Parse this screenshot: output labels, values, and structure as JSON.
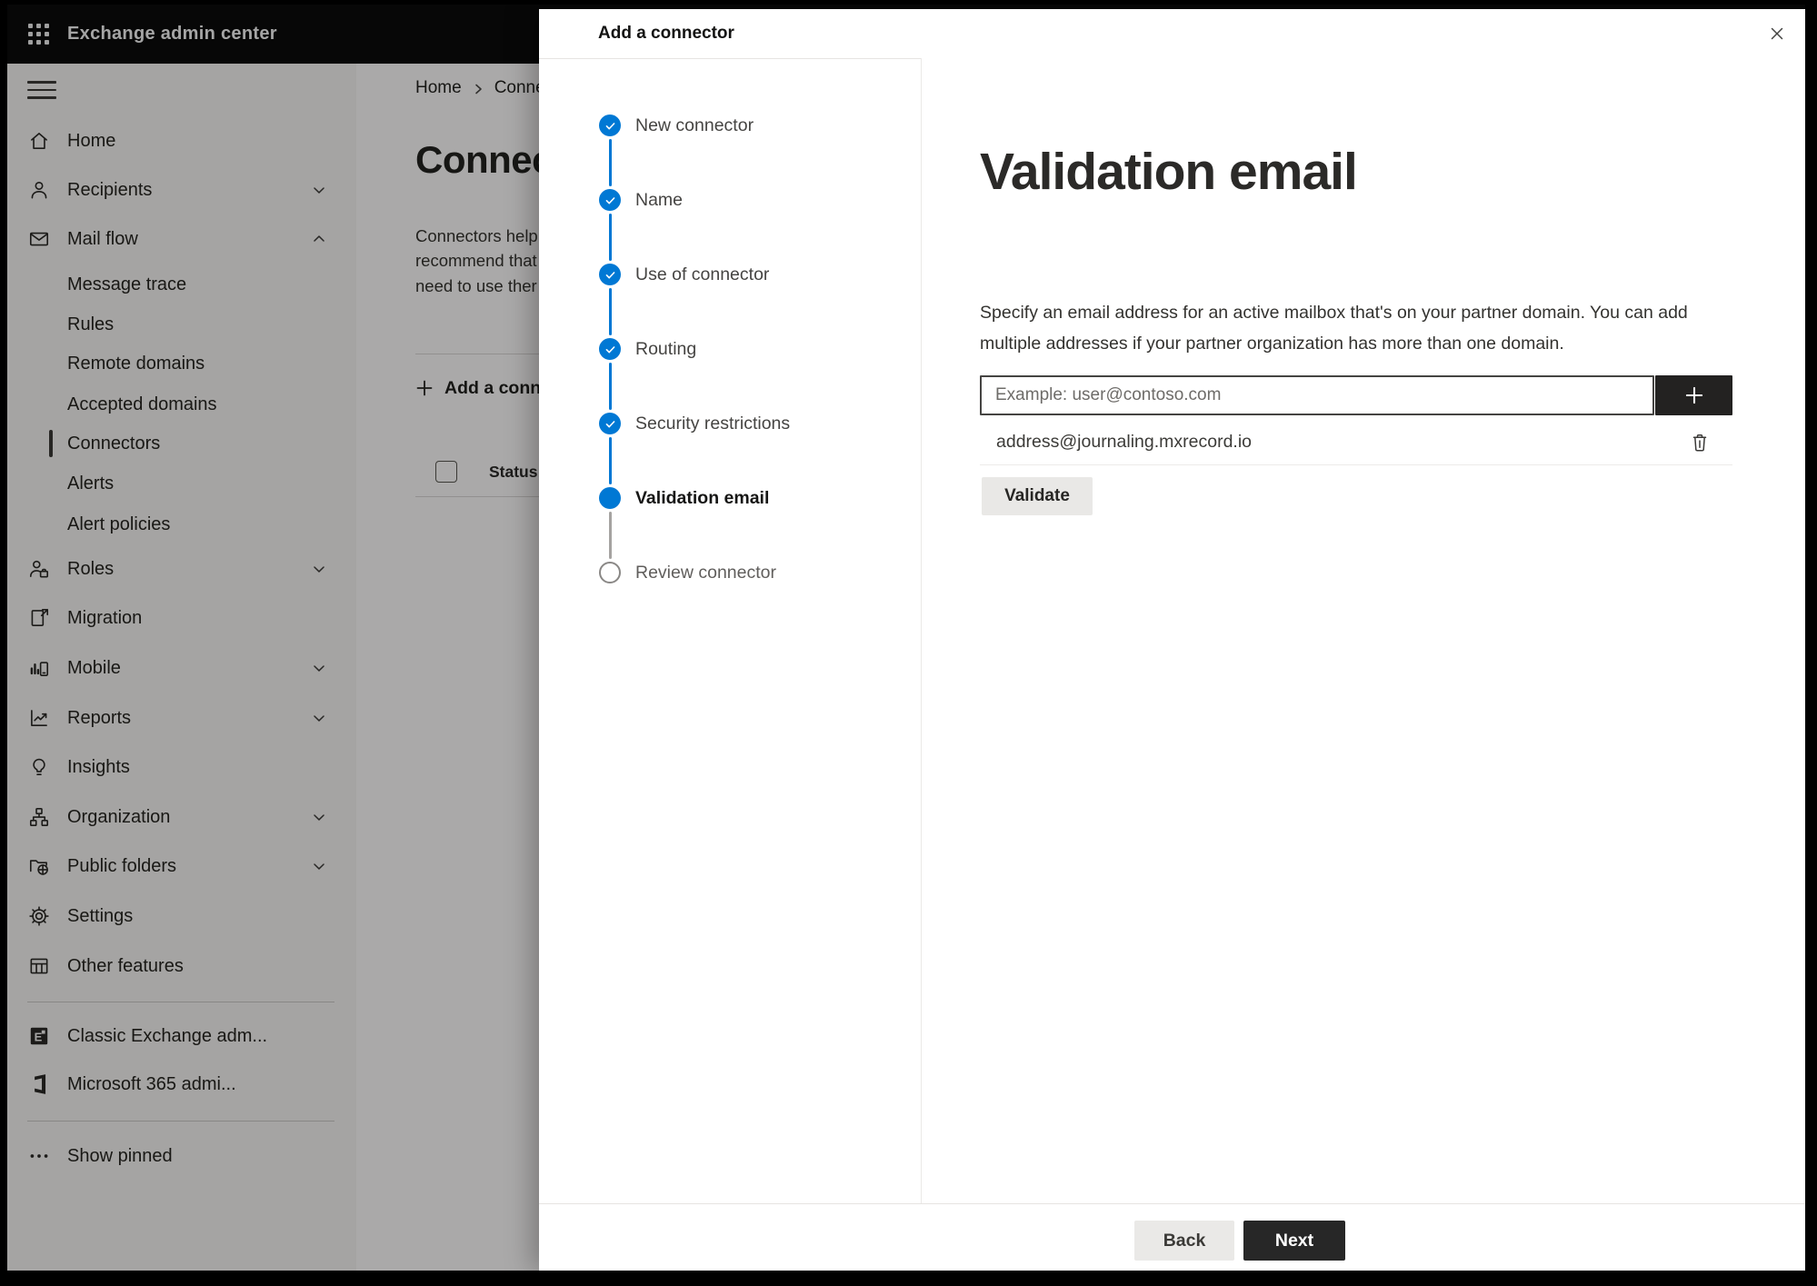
{
  "window": {
    "title": "Exchange admin center"
  },
  "sidebar": {
    "items": [
      {
        "label": "Home"
      },
      {
        "label": "Recipients",
        "expandable": true,
        "expanded": false
      },
      {
        "label": "Mail flow",
        "expandable": true,
        "expanded": true
      },
      {
        "label": "Message trace"
      },
      {
        "label": "Rules"
      },
      {
        "label": "Remote domains"
      },
      {
        "label": "Accepted domains"
      },
      {
        "label": "Connectors",
        "selected": true
      },
      {
        "label": "Alerts"
      },
      {
        "label": "Alert policies"
      },
      {
        "label": "Roles",
        "expandable": true,
        "expanded": false
      },
      {
        "label": "Migration"
      },
      {
        "label": "Mobile",
        "expandable": true,
        "expanded": false
      },
      {
        "label": "Reports",
        "expandable": true,
        "expanded": false
      },
      {
        "label": "Insights"
      },
      {
        "label": "Organization",
        "expandable": true,
        "expanded": false
      },
      {
        "label": "Public folders",
        "expandable": true,
        "expanded": false
      },
      {
        "label": "Settings"
      },
      {
        "label": "Other features"
      },
      {
        "label": "Classic Exchange adm..."
      },
      {
        "label": "Microsoft 365 admi..."
      },
      {
        "label": "Show pinned"
      }
    ]
  },
  "page": {
    "breadcrumb": {
      "home": "Home",
      "current": "Conne"
    },
    "title": "Connect",
    "intro_lines": [
      "Connectors help",
      "recommend that",
      "need to use ther"
    ],
    "add_connector_label": "Add a conn",
    "table": {
      "column_status": "Status"
    }
  },
  "dialog": {
    "title": "Add a connector",
    "steps": [
      {
        "label": "New connector",
        "state": "done"
      },
      {
        "label": "Name",
        "state": "done"
      },
      {
        "label": "Use of connector",
        "state": "done"
      },
      {
        "label": "Routing",
        "state": "done"
      },
      {
        "label": "Security restrictions",
        "state": "done"
      },
      {
        "label": "Validation email",
        "state": "active"
      },
      {
        "label": "Review connector",
        "state": "todo"
      }
    ],
    "heading": "Validation email",
    "description": "Specify an email address for an active mailbox that's on your partner domain. You can add multiple addresses if your partner organization has more than one domain.",
    "email_input": {
      "value": "",
      "placeholder": "Example: user@contoso.com"
    },
    "added_addresses": [
      "address@journaling.mxrecord.io"
    ],
    "validate_label": "Validate",
    "back_label": "Back",
    "next_label": "Next"
  },
  "colors": {
    "accent": "#0078d4",
    "topbar_bg": "#0b0b0b",
    "sidebar_bg": "#f3f2f1",
    "primary_button_bg": "#272727",
    "overlay": "rgba(0,0,0,0.32)"
  }
}
